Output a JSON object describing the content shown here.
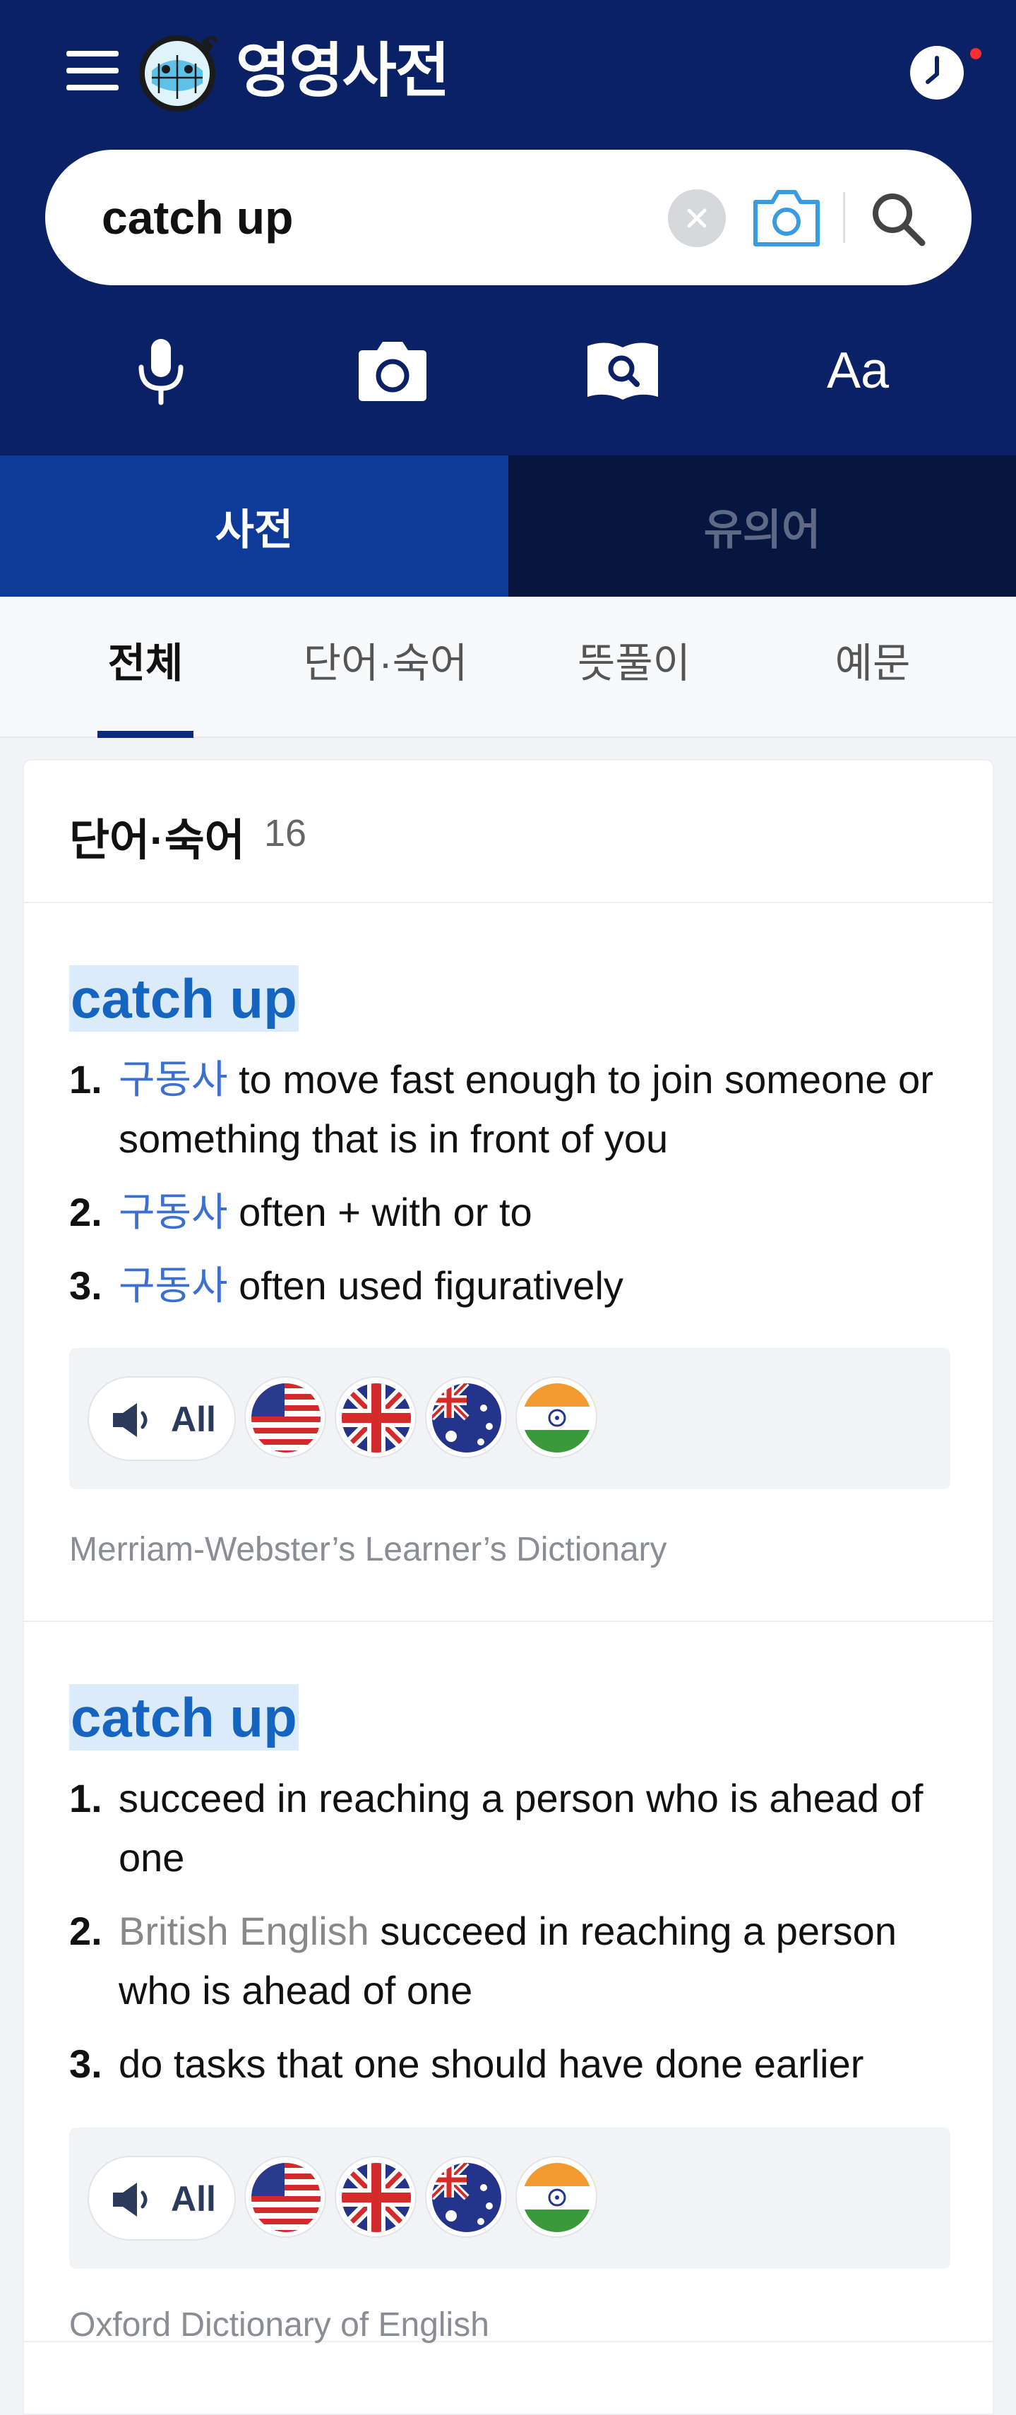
{
  "header": {
    "app_title": "영영사전",
    "icons": [
      "menu-icon",
      "mascot-logo",
      "clock-icon"
    ]
  },
  "search": {
    "query": "catch up",
    "icons": [
      "clear-icon",
      "camera-icon",
      "search-icon"
    ]
  },
  "tools": {
    "font_label": "Aa",
    "icons": [
      "microphone-icon",
      "camera-icon",
      "book-search-icon",
      "font-size-icon"
    ]
  },
  "main_tabs": [
    {
      "label": "사전",
      "active": true
    },
    {
      "label": "유의어",
      "active": false
    }
  ],
  "sub_tabs": [
    {
      "label": "전체",
      "active": true
    },
    {
      "label": "단어·숙어",
      "active": false
    },
    {
      "label": "뜻풀이",
      "active": false
    },
    {
      "label": "예문",
      "active": false
    }
  ],
  "section": {
    "title": "단어·숙어",
    "count": "16"
  },
  "entries": [
    {
      "headword": "catch up",
      "senses": [
        {
          "num": "1.",
          "pos": "구동사",
          "text": "to move fast enough to join someone or something that is in front of you"
        },
        {
          "num": "2.",
          "pos": "구동사",
          "text": "often + with or to"
        },
        {
          "num": "3.",
          "pos": "구동사",
          "text": "often used figuratively"
        }
      ],
      "audio": {
        "all_label": "All",
        "accents": [
          "US",
          "UK",
          "AU",
          "IN"
        ]
      },
      "source": "Merriam-Webster’s Learner’s Dictionary"
    },
    {
      "headword": "catch up",
      "senses": [
        {
          "num": "1.",
          "region": "",
          "text": "succeed in reaching a person who is ahead of one"
        },
        {
          "num": "2.",
          "region": "British English",
          "text": "succeed in reaching a person who is ahead of one"
        },
        {
          "num": "3.",
          "region": "",
          "text": "do tasks that one should have done earlier"
        }
      ],
      "audio": {
        "all_label": "All",
        "accents": [
          "US",
          "UK",
          "AU",
          "IN"
        ]
      },
      "source": "Oxford Dictionary of English"
    }
  ],
  "colors": {
    "header_bg": "#0a2265",
    "tab_active": "#0e3a99",
    "tab_inactive": "#06163f",
    "headword": "#1565c0",
    "headword_highlight": "#dcebfa",
    "pos": "#3b6fd0",
    "notification_dot": "#ff2d2d"
  }
}
